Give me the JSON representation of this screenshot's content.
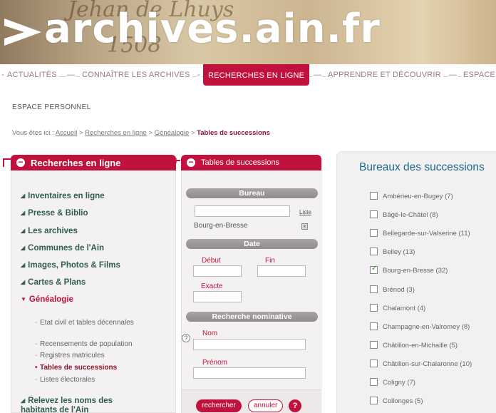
{
  "site": {
    "logo_text": "archives.ain.fr",
    "banner_scribble_1": "Jehan de Lhuys",
    "banner_scribble_2": "1508"
  },
  "nav": {
    "items": [
      {
        "label": "ACTUALITÉS"
      },
      {
        "label": "CONNAÎTRE LES ARCHIVES"
      },
      {
        "label": "RECHERCHES EN LIGNE",
        "active": true
      },
      {
        "label": "APPRENDRE ET DÉCOUVRIR"
      },
      {
        "label": "ESPACE"
      }
    ],
    "second_row": "ESPACE PERSONNEL"
  },
  "breadcrumb": {
    "prefix": "Vous êtes ici :",
    "items": [
      "Accueil",
      "Recherches en ligne",
      "Généalogie"
    ],
    "current": "Tables de successions",
    "separator": ">"
  },
  "left_panel": {
    "title": "Recherches en ligne",
    "items": [
      "Inventaires en ligne",
      "Presse & Biblio",
      "Les archives",
      "Communes de l'Ain",
      "Images, Photos & Films",
      "Cartes & Plans",
      "Généalogie",
      "Relevez les noms des habitants de l'Ain"
    ],
    "sub_items": [
      "Etat civil et tables décennales",
      "Recensements de population",
      "Registres matricules",
      "Tables de successions",
      "Listes électorales"
    ]
  },
  "search_panel": {
    "title": "Tables de successions",
    "section_bureau": "Bureau",
    "bureau_value": "",
    "liste_link": "Liste",
    "selected_bureau": "Bourg-en-Bresse",
    "section_date": "Date",
    "label_debut": "Début",
    "label_fin": "Fin",
    "label_exacte": "Exacte",
    "section_nominative": "Recherche nominative",
    "label_nom": "Nom",
    "label_prenom": "Prénom",
    "btn_search": "rechercher",
    "btn_cancel": "annuler",
    "btn_help": "?"
  },
  "right_panel": {
    "title": "Bureaux des successions",
    "bureaux": [
      {
        "label": "Ambérieu-en-Bugey (7)",
        "checked": false
      },
      {
        "label": "Bâgé-le-Châtel (8)",
        "checked": false
      },
      {
        "label": "Bellegarde-sur-Valserine (11)",
        "checked": false
      },
      {
        "label": "Belley (13)",
        "checked": false
      },
      {
        "label": "Bourg-en-Bresse (32)",
        "checked": true
      },
      {
        "label": "Brénod (3)",
        "checked": false
      },
      {
        "label": "Chalamont (4)",
        "checked": false
      },
      {
        "label": "Champagne-en-Valromey (8)",
        "checked": false
      },
      {
        "label": "Châtillon-en-Michaille (5)",
        "checked": false
      },
      {
        "label": "Châtillon-sur-Chalaronne (10)",
        "checked": false
      },
      {
        "label": "Coligny (7)",
        "checked": false
      },
      {
        "label": "Collonges (5)",
        "checked": false
      }
    ]
  },
  "colors": {
    "accent": "#c0123c",
    "menu_green": "#2f5e4c",
    "title_blue": "#1d6b8a"
  }
}
